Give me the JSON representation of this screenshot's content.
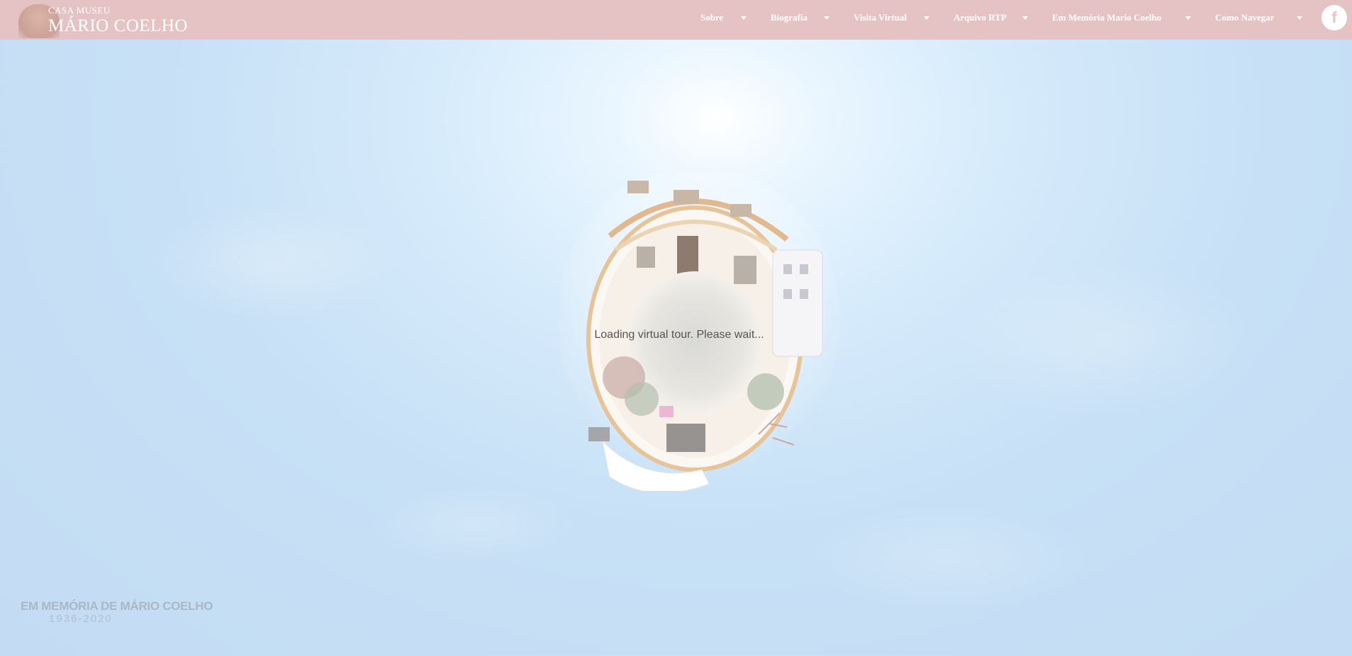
{
  "header": {
    "logo_small": "CASA MUSEU",
    "logo_big": "MÁRIO COELHO",
    "nav": [
      {
        "label": "Sobre"
      },
      {
        "label": "Biografia"
      },
      {
        "label": "Visita Virtual"
      },
      {
        "label": "Arquivo RTP"
      },
      {
        "label": "Em Memória Mario Coelho"
      },
      {
        "label": "Como Navegar"
      }
    ],
    "facebook_glyph": "f"
  },
  "main": {
    "loading_text": "Loading virtual tour. Please wait..."
  },
  "footer_overlay": {
    "memorial_title": "EM MEMÓRIA DE MÁRIO COELHO",
    "memorial_years": "1936-2020"
  },
  "colors": {
    "header_bg": "#e5c2c3",
    "sky": "#c7e0f6"
  },
  "icons": {
    "dropdown": "chevron-down-icon",
    "social": "facebook-icon"
  }
}
